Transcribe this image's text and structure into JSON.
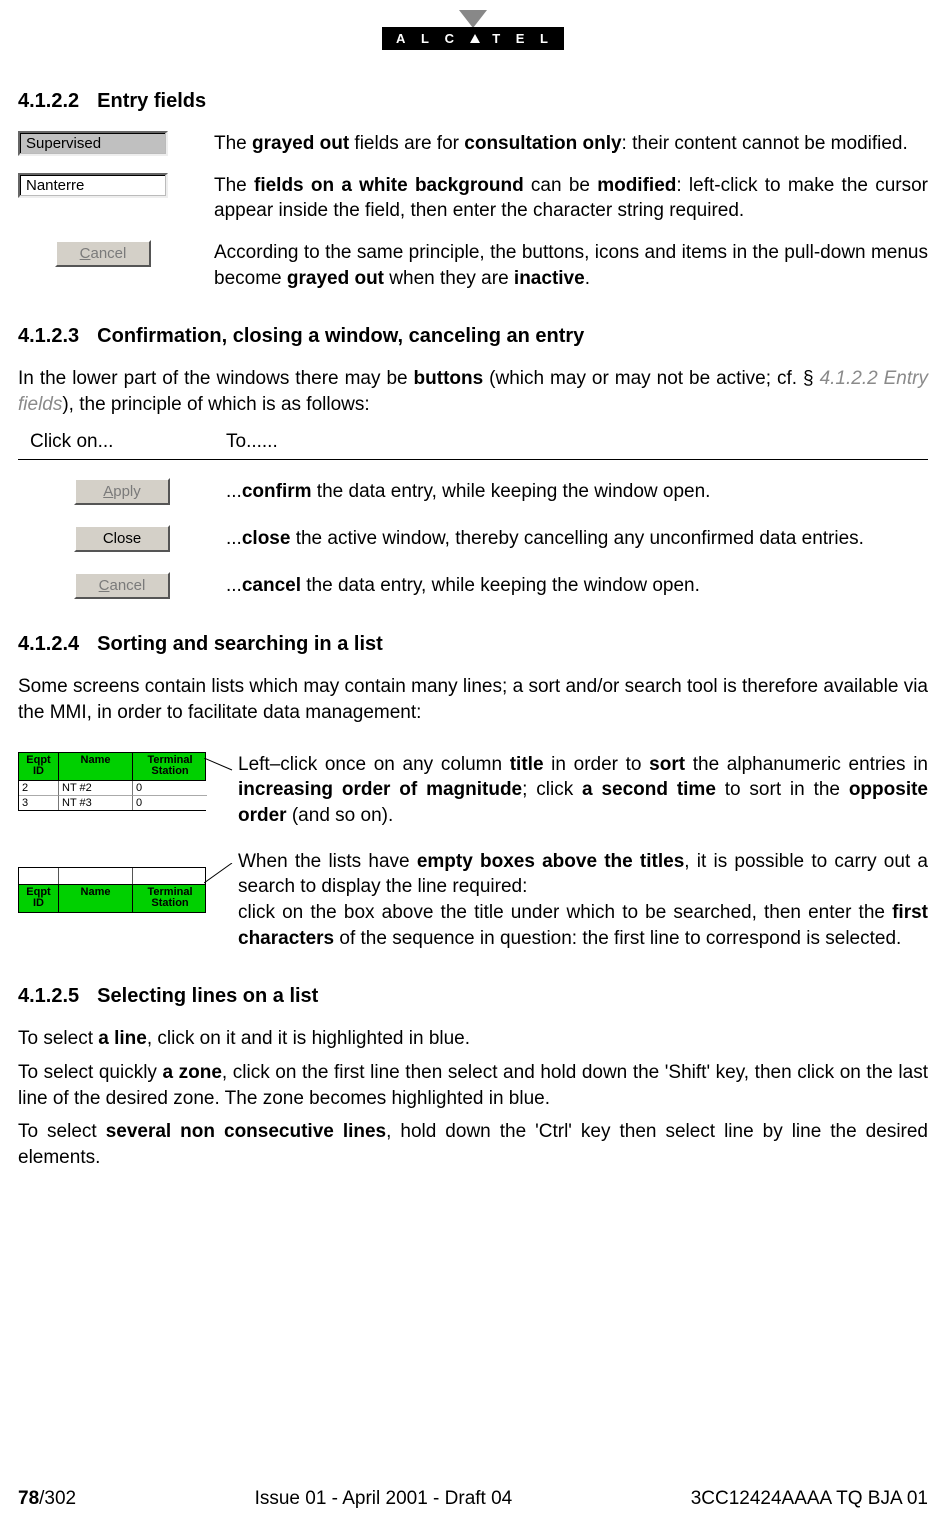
{
  "logo_text": "A L C T E L",
  "section_4122": {
    "num": "4.1.2.2",
    "title": "Entry fields",
    "grayed_value": "Supervised",
    "white_value": "Nanterre",
    "cancel_label": "Cancel",
    "p1_pre": "The ",
    "p1_b1": "grayed out",
    "p1_mid1": " fields are for ",
    "p1_b2": "consultation only",
    "p1_post": ": their content cannot be modified.",
    "p2_pre": "The ",
    "p2_b1": "fields on a white background",
    "p2_mid1": " can be ",
    "p2_b2": "modified",
    "p2_post": ": left-click to make the cursor appear inside the field, then enter the character string required.",
    "p3_pre": "According to the same principle, the buttons, icons and items in the pull-down menus become ",
    "p3_b1": "grayed out",
    "p3_mid": " when they are ",
    "p3_b2": "inactive",
    "p3_post": "."
  },
  "section_4123": {
    "num": "4.1.2.3",
    "title": "Confirmation, closing a window, canceling an entry",
    "intro_pre": "In the lower part of the windows there may be ",
    "intro_b": "buttons",
    "intro_mid": " (which may or may not be active; cf. § ",
    "intro_ref": "4.1.2.2 Entry fields",
    "intro_post": "), the principle of which is as follows:",
    "col_click": "Click on...",
    "col_to": "To......",
    "rows": [
      {
        "btn": "Apply",
        "underline_first": true,
        "grayed": true,
        "pre": "...",
        "b": "confirm",
        "post": " the data entry, while keeping the window open."
      },
      {
        "btn": "Close",
        "underline_first": false,
        "grayed": false,
        "pre": "...",
        "b": "close",
        "post": " the active window, thereby cancelling any unconfirmed data entries."
      },
      {
        "btn": "Cancel",
        "underline_first": true,
        "grayed": true,
        "pre": "...",
        "b": "cancel",
        "post": " the data entry, while keeping the window open."
      }
    ]
  },
  "section_4124": {
    "num": "4.1.2.4",
    "title": "Sorting and searching in a list",
    "intro": "Some screens contain lists which may contain many lines; a sort and/or search tool is therefore available via the MMI, in order to facilitate data management:",
    "headers": {
      "id": "Eqpt ID",
      "name": "Name",
      "ts": "Terminal Station"
    },
    "data_rows": [
      {
        "id": "2",
        "name": "NT #2",
        "ts": "0"
      },
      {
        "id": "3",
        "name": "NT #3",
        "ts": "0"
      }
    ],
    "sort_pre": "Left–click once on any column ",
    "sort_b1": "title",
    "sort_mid1": " in order to ",
    "sort_b2": "sort",
    "sort_mid2": " the alphanumeric entries in ",
    "sort_b3": "increasing order of magnitude",
    "sort_mid3": "; click ",
    "sort_b4": "a second time",
    "sort_mid4": " to sort in the ",
    "sort_b5": "opposite order",
    "sort_post": " (and so on).",
    "search_p1_pre": "When the lists have ",
    "search_p1_b": "empty boxes above the titles",
    "search_p1_post": ", it is possible to carry out a search to display the line required:",
    "search_p2_pre": "click on the box above the title under which to be searched, then enter the ",
    "search_p2_b": "first characters",
    "search_p2_post": " of the sequence in question: the first line to correspond is selected."
  },
  "section_4125": {
    "num": "4.1.2.5",
    "title": "Selecting lines on a list",
    "p1_pre": "To select ",
    "p1_b": "a line",
    "p1_post": ", click on it and it is highlighted in blue.",
    "p2_pre": "To select quickly ",
    "p2_b": "a zone",
    "p2_post": ", click on the first line then select and hold down the 'Shift' key, then click on the last line of the desired zone. The zone becomes highlighted in blue.",
    "p3_pre": "To select ",
    "p3_b": "several non consecutive lines",
    "p3_post": ", hold down the 'Ctrl' key then select line by line the desired elements."
  },
  "footer": {
    "page_bold": "78",
    "page_rest": "/302",
    "center": "Issue 01 - April 2001 - Draft 04",
    "right": "3CC12424AAAA TQ BJA 01"
  }
}
